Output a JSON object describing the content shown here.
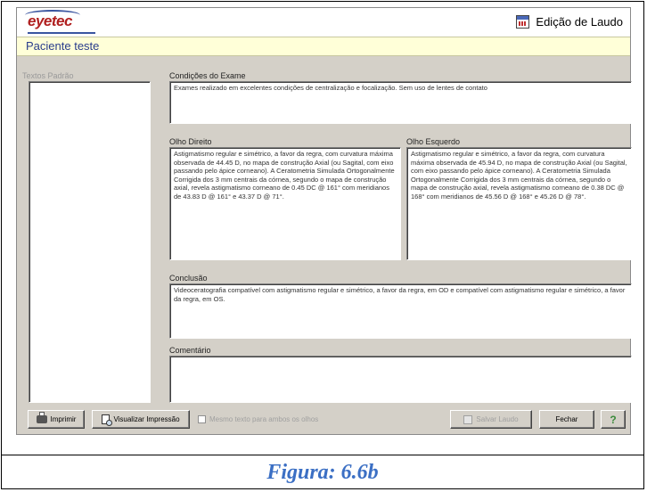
{
  "app": {
    "logo": "eyetec",
    "window_title": "Edição de Laudo",
    "calendar_icon": "calendar-icon"
  },
  "patient_name": "Paciente teste",
  "sidebar": {
    "label": "Textos Padrão"
  },
  "fields": {
    "conditions": {
      "label": "Condições do Exame",
      "text": "Exames realizado em excelentes condições de centralização e focalização. Sem uso de lentes de contato"
    },
    "right_eye": {
      "label": "Olho Direito",
      "text": "Astigmatismo regular e simétrico, a favor da regra, com curvatura máxima observada de 44.45 D, no mapa de construção Axial (ou Sagital, com eixo passando pelo ápice corneano). A Ceratometria Simulada Ortogonalmente Corrigida dos 3 mm centrais da córnea, segundo o mapa de construção axial, revela astigmatismo corneano de 0.45 DC @ 161° com meridianos de 43.83 D @ 161° e 43.37 D @ 71°."
    },
    "left_eye": {
      "label": "Olho Esquerdo",
      "text": "Astigmatismo regular e simétrico, a favor da regra, com curvatura máxima observada de 45.94 D, no mapa de construção Axial (ou Sagital, com eixo passando pelo ápice corneano). A Ceratometria Simulada Ortogonalmente Corrigida dos 3 mm centrais da córnea, segundo o mapa de construção axial, revela astigmatismo corneano de 0.38 DC @ 168° com meridianos de 45.56 D @ 168° e 45.26 D @ 78°."
    },
    "conclusion": {
      "label": "Conclusão",
      "text": "Videoceratografia compatível com astigmatismo regular e simétrico, a favor da regra, em OD e compatível com astigmatismo regular e simétrico, a favor da regra, em OS."
    },
    "comments": {
      "label": "Comentário",
      "text": ""
    }
  },
  "buttons": {
    "print": "Imprimir",
    "preview": "Visualizar Impressão",
    "same_for_both": "Mesmo texto para ambos os olhos",
    "save": "Salvar Laudo",
    "close": "Fechar",
    "help": "?"
  },
  "caption": "Figura: 6.6b"
}
